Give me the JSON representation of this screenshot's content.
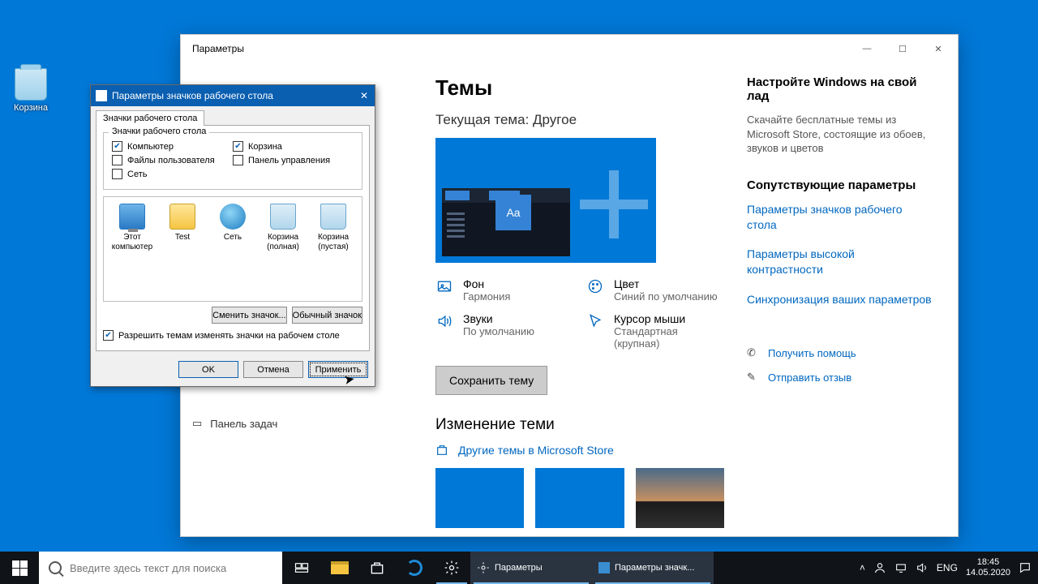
{
  "desktop": {
    "recycle_label": "Корзина"
  },
  "settings": {
    "title": "Параметры",
    "sidebar_taskbar": "Панель задач",
    "themes": {
      "heading": "Темы",
      "current": "Текущая тема: Другое",
      "aa": "Aa",
      "bg_label": "Фон",
      "bg_val": "Гармония",
      "color_label": "Цвет",
      "color_val": "Синий по умолчанию",
      "sound_label": "Звуки",
      "sound_val": "По умолчанию",
      "cursor_label": "Курсор мыши",
      "cursor_val": "Стандартная (крупная)",
      "save_btn": "Сохранить тему",
      "change_h": "Изменение теми",
      "more_store": "Другие темы в Microsoft Store"
    },
    "right": {
      "h1": "Настройте Windows на свой лад",
      "p1": "Скачайте бесплатные темы из Microsoft Store, состоящие из обоев, звуков и цветов",
      "h2": "Сопутствующие параметры",
      "l1": "Параметры значков рабочего стола",
      "l2": "Параметры высокой контрастности",
      "l3": "Синхронизация ваших параметров",
      "help": "Получить помощь",
      "feedback": "Отправить отзыв"
    }
  },
  "dialog": {
    "title": "Параметры значков рабочего стола",
    "tab": "Значки рабочего стола",
    "legend": "Значки рабочего стола",
    "chk_computer": "Компьютер",
    "chk_bin": "Корзина",
    "chk_userfiles": "Файлы пользователя",
    "chk_cpanel": "Панель управления",
    "chk_network": "Сеть",
    "icon_pc": "Этот компьютер",
    "icon_test": "Test",
    "icon_net": "Сеть",
    "icon_bin_full": "Корзина (полная)",
    "icon_bin_empty": "Корзина (пустая)",
    "btn_change": "Сменить значок...",
    "btn_default": "Обычный значок",
    "chk_allow": "Разрешить темам изменять значки на рабочем столе",
    "ok": "OK",
    "cancel": "Отмена",
    "apply": "Применить"
  },
  "taskbar": {
    "search_ph": "Введите здесь текст для поиска",
    "task_settings": "Параметры",
    "task_dialog": "Параметры значк...",
    "lang": "ENG",
    "time": "18:45",
    "date": "14.05.2020"
  }
}
